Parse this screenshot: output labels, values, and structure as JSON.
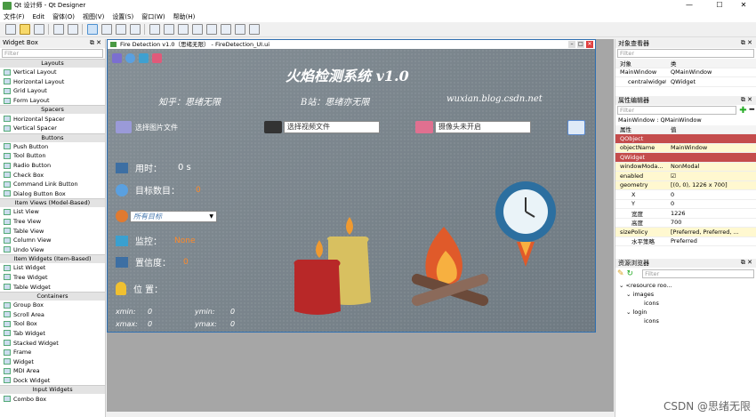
{
  "window": {
    "title": "Qt 设计师 - Qt Designer",
    "min": "—",
    "max": "☐",
    "close": "✕"
  },
  "menu": [
    "文件(F)",
    "Edit",
    "窗体(O)",
    "视图(V)",
    "设置(S)",
    "窗口(W)",
    "帮助(H)"
  ],
  "widget_box": {
    "title": "Widget Box",
    "filter_placeholder": "Filter",
    "groups": [
      {
        "name": "Layouts",
        "items": [
          "Vertical Layout",
          "Horizontal Layout",
          "Grid Layout",
          "Form Layout"
        ]
      },
      {
        "name": "Spacers",
        "items": [
          "Horizontal Spacer",
          "Vertical Spacer"
        ]
      },
      {
        "name": "Buttons",
        "items": [
          "Push Button",
          "Tool Button",
          "Radio Button",
          "Check Box",
          "Command Link Button",
          "Dialog Button Box"
        ]
      },
      {
        "name": "Item Views (Model-Based)",
        "items": [
          "List View",
          "Tree View",
          "Table View",
          "Column View",
          "Undo View"
        ]
      },
      {
        "name": "Item Widgets (Item-Based)",
        "items": [
          "List Widget",
          "Tree Widget",
          "Table Widget"
        ]
      },
      {
        "name": "Containers",
        "items": [
          "Group Box",
          "Scroll Area",
          "Tool Box",
          "Tab Widget",
          "Stacked Widget",
          "Frame",
          "Widget",
          "MDI Area",
          "Dock Widget"
        ]
      },
      {
        "name": "Input Widgets",
        "items": [
          "Combo Box"
        ]
      }
    ]
  },
  "designer": {
    "title": "Fire Detection v1.0（思绪无限） - FireDetection_UI.ui",
    "app_title": "火焰检测系统 v1.0",
    "author": "知乎：思绪无限",
    "bili": "B站：思绪亦无限",
    "site": "wuxian.blog.csdn.net",
    "img_btn": "选择图片文件",
    "video_field": "选择视频文件",
    "cam_field": "摄像头未开启",
    "time_label": "用时：",
    "time_val": "0 s",
    "count_label": "目标数目：",
    "count_val": "0",
    "combo": "所有目标",
    "monitor_label": "监控：",
    "monitor_val": "None",
    "conf_label": "置信度：",
    "conf_val": "0",
    "pos_label": "位 置：",
    "xmin": "xmin:",
    "xmin_v": "0",
    "ymin": "ymin:",
    "ymin_v": "0",
    "xmax": "xmax:",
    "xmax_v": "0",
    "ymax": "ymax:",
    "ymax_v": "0"
  },
  "object_inspector": {
    "title": "对象查看器",
    "filter": "Filter",
    "col_obj": "对象",
    "col_class": "类",
    "rows": [
      [
        "MainWindow",
        "QMainWindow"
      ],
      [
        "centralwidget",
        "QWidget"
      ]
    ]
  },
  "property_editor": {
    "title": "属性编辑器",
    "filter": "Filter",
    "context": "MainWindow : QMainWindow",
    "col_prop": "属性",
    "col_val": "值",
    "rows": [
      {
        "p": "QObject",
        "v": "",
        "type": "sec"
      },
      {
        "p": "objectName",
        "v": "MainWindow",
        "type": "yel"
      },
      {
        "p": "QWidget",
        "v": "",
        "type": "sec"
      },
      {
        "p": "windowModa...",
        "v": "NonModal",
        "type": "yel"
      },
      {
        "p": "enabled",
        "v": "☑",
        "type": "yel"
      },
      {
        "p": "geometry",
        "v": "[(0, 0), 1226 x 700]",
        "type": "yel"
      },
      {
        "p": "X",
        "v": "0",
        "type": "sub"
      },
      {
        "p": "Y",
        "v": "0",
        "type": "sub"
      },
      {
        "p": "宽度",
        "v": "1226",
        "type": "sub"
      },
      {
        "p": "高度",
        "v": "700",
        "type": "sub"
      },
      {
        "p": "sizePolicy",
        "v": "[Preferred, Preferred, ...",
        "type": "yel"
      },
      {
        "p": "水平策略",
        "v": "Preferred",
        "type": "sub"
      }
    ]
  },
  "resource_browser": {
    "title": "资源浏览器",
    "filter": "Filter",
    "tree": [
      "<resource roo...",
      "images",
      "icons",
      "login",
      "icons"
    ]
  },
  "watermark": "CSDN @思绪无限"
}
